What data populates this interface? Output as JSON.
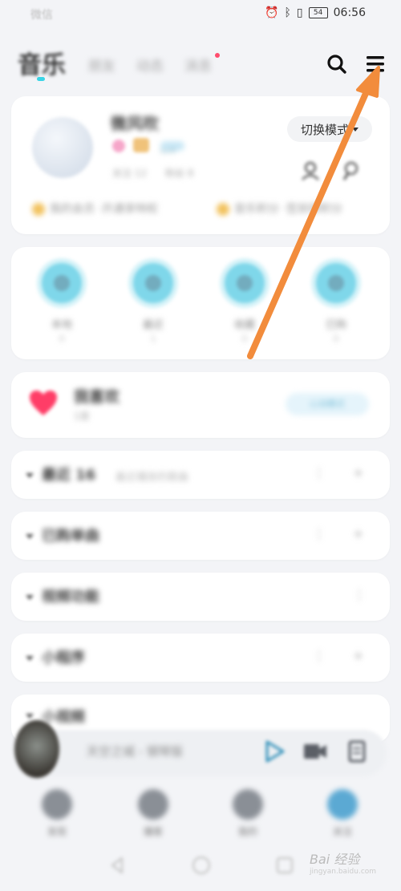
{
  "status_bar": {
    "carrier": "微信",
    "battery": "54",
    "time": "06:56"
  },
  "header": {
    "title": "音乐",
    "tabs": [
      "朋友",
      "动态",
      "消息"
    ],
    "search_icon": "search-icon",
    "menu_icon": "menu-icon"
  },
  "profile": {
    "username": "微风吹",
    "level": "Lv.9",
    "follows": "关注 12",
    "fans": "粉丝 8",
    "mode_button": "切换模式",
    "vip_left": "我的会员 ·开通享特权",
    "vip_right": "音乐积分 ·签到得积分"
  },
  "shortcuts": [
    {
      "label": "本地",
      "count": "0"
    },
    {
      "label": "最近",
      "count": "1"
    },
    {
      "label": "收藏",
      "count": "0"
    },
    {
      "label": "已购",
      "count": "0"
    }
  ],
  "liked": {
    "title": "我喜欢",
    "subtitle": "1首",
    "mode": "心动模式"
  },
  "lists": [
    {
      "title": "最近 16",
      "subtitle": "最近播放的歌曲"
    },
    {
      "title": "已购单曲",
      "subtitle": ""
    },
    {
      "title": "视频功能",
      "subtitle": ""
    },
    {
      "title": "小程序",
      "subtitle": ""
    },
    {
      "title": "小视频",
      "subtitle": ""
    }
  ],
  "player": {
    "text": "天空之城 - 钢琴版"
  },
  "bottom_nav": [
    "发现",
    "播客",
    "我的",
    "关注"
  ],
  "watermark": {
    "brand": "Bai 经验",
    "url": "jingyan.baidu.com"
  },
  "colors": {
    "accent": "#3ad4e6",
    "arrow": "#f28c3c",
    "heart": "#ff3d67"
  }
}
